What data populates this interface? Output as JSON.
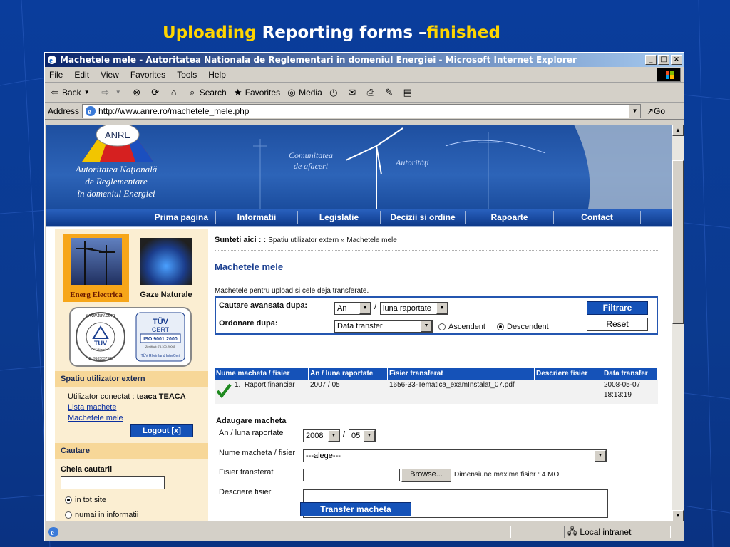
{
  "slide": {
    "title_part1": "Uploading",
    "title_part2": " Reporting forms –",
    "title_part3": "finished"
  },
  "browser": {
    "window_title": "Machetele mele - Autoritatea Nationala de Reglementari in domeniul Energiei - Microsoft Internet Explorer",
    "menu": [
      "File",
      "Edit",
      "View",
      "Favorites",
      "Tools",
      "Help"
    ],
    "toolbar": {
      "back": "Back",
      "search": "Search",
      "favorites": "Favorites",
      "media": "Media"
    },
    "address_label": "Address",
    "url": "http://www.anre.ro/machetele_mele.php",
    "go": "Go",
    "status_zone": "Local intranet"
  },
  "site": {
    "logo_text": "ANRE",
    "org_line1": "Autoritatea Națională",
    "org_line2": "de Reglementare",
    "org_line3": "în domeniul Energiei",
    "banner_tag1_line1": "Comunitatea",
    "banner_tag1_line2": "de afaceri",
    "banner_tag2": "Autorități",
    "nav": [
      "Prima pagina",
      "Informatii",
      "Legislatie",
      "Decizii si ordine",
      "Rapoarte",
      "Contact"
    ]
  },
  "left": {
    "energ_label": "Energ Electrica",
    "gaze_label": "Gaze Naturale",
    "tuv": {
      "url": "www.tuv.com",
      "tuv": "TÜV",
      "rheinland": "TÜV Rheinland",
      "id": "ID: 9105037983",
      "cert_tuv": "TÜV",
      "cert": "CERT",
      "iso": "ISO 9001:2000",
      "zert": "Zertifikat: 78.100.20065",
      "intercert": "TÜV Rheinland InterCert"
    },
    "section_user": "Spatiu utilizator extern",
    "connected_label": "Utilizator conectat : ",
    "connected_user": "teaca TEACA",
    "link_list": "Lista machete",
    "link_mine": "Machetele mele",
    "logout": "Logout [x]",
    "section_search": "Cautare",
    "search_key_label": "Cheia cautarii",
    "search_key_value": "",
    "radio_all": "in tot site",
    "radio_info": "numai in informatii"
  },
  "main": {
    "breadcrumb_label": "Sunteti aici  : : ",
    "breadcrumb_path": "Spatiu utilizator extern » Machetele mele",
    "title": "Machetele mele",
    "description": "Machetele pentru upload si cele deja transferate.",
    "adv_search_label": "Cautare avansata dupa:",
    "order_label": "Ordonare dupa:",
    "year_select": "An",
    "month_select": "luna raportate",
    "order_select": "Data transfer",
    "asc": "Ascendent",
    "desc": "Descendent",
    "filter_button": "Filtrare",
    "reset_button": "Reset",
    "table": {
      "headers": [
        "Nume macheta / fisier",
        "An / luna raportate",
        "Fisier transferat",
        "Descriere fisier",
        "Data transfer"
      ],
      "rows": [
        {
          "num": "1.",
          "name": "Raport financiar",
          "period": "2007 / 05",
          "file": "1656-33-Tematica_examInstalat_07.pdf",
          "desc": "",
          "date": "2008-05-07",
          "time": "18:13:19"
        }
      ]
    },
    "add_title": "Adaugare macheta",
    "add_period_label": "An / luna raportate",
    "add_year": "2008",
    "add_month": "05",
    "add_name_label": "Nume macheta / fisier",
    "add_name_value": "---alege---",
    "add_file_label": "Fisier transferat",
    "add_file_value": "",
    "browse": "Browse...",
    "max_size": "Dimensiune maxima fisier : 4 MO",
    "add_desc_label": "Descriere fisier",
    "transfer_button": "Transfer macheta"
  }
}
